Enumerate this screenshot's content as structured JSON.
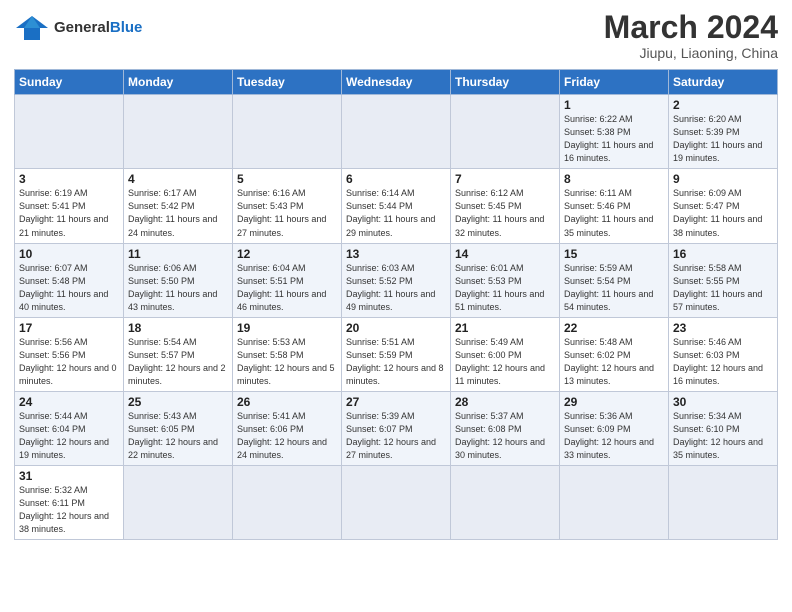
{
  "header": {
    "logo_general": "General",
    "logo_blue": "Blue",
    "month_year": "March 2024",
    "location": "Jiupu, Liaoning, China"
  },
  "weekdays": [
    "Sunday",
    "Monday",
    "Tuesday",
    "Wednesday",
    "Thursday",
    "Friday",
    "Saturday"
  ],
  "weeks": [
    [
      {
        "day": "",
        "info": ""
      },
      {
        "day": "",
        "info": ""
      },
      {
        "day": "",
        "info": ""
      },
      {
        "day": "",
        "info": ""
      },
      {
        "day": "",
        "info": ""
      },
      {
        "day": "1",
        "info": "Sunrise: 6:22 AM\nSunset: 5:38 PM\nDaylight: 11 hours and 16 minutes."
      },
      {
        "day": "2",
        "info": "Sunrise: 6:20 AM\nSunset: 5:39 PM\nDaylight: 11 hours and 19 minutes."
      }
    ],
    [
      {
        "day": "3",
        "info": "Sunrise: 6:19 AM\nSunset: 5:41 PM\nDaylight: 11 hours and 21 minutes."
      },
      {
        "day": "4",
        "info": "Sunrise: 6:17 AM\nSunset: 5:42 PM\nDaylight: 11 hours and 24 minutes."
      },
      {
        "day": "5",
        "info": "Sunrise: 6:16 AM\nSunset: 5:43 PM\nDaylight: 11 hours and 27 minutes."
      },
      {
        "day": "6",
        "info": "Sunrise: 6:14 AM\nSunset: 5:44 PM\nDaylight: 11 hours and 29 minutes."
      },
      {
        "day": "7",
        "info": "Sunrise: 6:12 AM\nSunset: 5:45 PM\nDaylight: 11 hours and 32 minutes."
      },
      {
        "day": "8",
        "info": "Sunrise: 6:11 AM\nSunset: 5:46 PM\nDaylight: 11 hours and 35 minutes."
      },
      {
        "day": "9",
        "info": "Sunrise: 6:09 AM\nSunset: 5:47 PM\nDaylight: 11 hours and 38 minutes."
      }
    ],
    [
      {
        "day": "10",
        "info": "Sunrise: 6:07 AM\nSunset: 5:48 PM\nDaylight: 11 hours and 40 minutes."
      },
      {
        "day": "11",
        "info": "Sunrise: 6:06 AM\nSunset: 5:50 PM\nDaylight: 11 hours and 43 minutes."
      },
      {
        "day": "12",
        "info": "Sunrise: 6:04 AM\nSunset: 5:51 PM\nDaylight: 11 hours and 46 minutes."
      },
      {
        "day": "13",
        "info": "Sunrise: 6:03 AM\nSunset: 5:52 PM\nDaylight: 11 hours and 49 minutes."
      },
      {
        "day": "14",
        "info": "Sunrise: 6:01 AM\nSunset: 5:53 PM\nDaylight: 11 hours and 51 minutes."
      },
      {
        "day": "15",
        "info": "Sunrise: 5:59 AM\nSunset: 5:54 PM\nDaylight: 11 hours and 54 minutes."
      },
      {
        "day": "16",
        "info": "Sunrise: 5:58 AM\nSunset: 5:55 PM\nDaylight: 11 hours and 57 minutes."
      }
    ],
    [
      {
        "day": "17",
        "info": "Sunrise: 5:56 AM\nSunset: 5:56 PM\nDaylight: 12 hours and 0 minutes."
      },
      {
        "day": "18",
        "info": "Sunrise: 5:54 AM\nSunset: 5:57 PM\nDaylight: 12 hours and 2 minutes."
      },
      {
        "day": "19",
        "info": "Sunrise: 5:53 AM\nSunset: 5:58 PM\nDaylight: 12 hours and 5 minutes."
      },
      {
        "day": "20",
        "info": "Sunrise: 5:51 AM\nSunset: 5:59 PM\nDaylight: 12 hours and 8 minutes."
      },
      {
        "day": "21",
        "info": "Sunrise: 5:49 AM\nSunset: 6:00 PM\nDaylight: 12 hours and 11 minutes."
      },
      {
        "day": "22",
        "info": "Sunrise: 5:48 AM\nSunset: 6:02 PM\nDaylight: 12 hours and 13 minutes."
      },
      {
        "day": "23",
        "info": "Sunrise: 5:46 AM\nSunset: 6:03 PM\nDaylight: 12 hours and 16 minutes."
      }
    ],
    [
      {
        "day": "24",
        "info": "Sunrise: 5:44 AM\nSunset: 6:04 PM\nDaylight: 12 hours and 19 minutes."
      },
      {
        "day": "25",
        "info": "Sunrise: 5:43 AM\nSunset: 6:05 PM\nDaylight: 12 hours and 22 minutes."
      },
      {
        "day": "26",
        "info": "Sunrise: 5:41 AM\nSunset: 6:06 PM\nDaylight: 12 hours and 24 minutes."
      },
      {
        "day": "27",
        "info": "Sunrise: 5:39 AM\nSunset: 6:07 PM\nDaylight: 12 hours and 27 minutes."
      },
      {
        "day": "28",
        "info": "Sunrise: 5:37 AM\nSunset: 6:08 PM\nDaylight: 12 hours and 30 minutes."
      },
      {
        "day": "29",
        "info": "Sunrise: 5:36 AM\nSunset: 6:09 PM\nDaylight: 12 hours and 33 minutes."
      },
      {
        "day": "30",
        "info": "Sunrise: 5:34 AM\nSunset: 6:10 PM\nDaylight: 12 hours and 35 minutes."
      }
    ],
    [
      {
        "day": "31",
        "info": "Sunrise: 5:32 AM\nSunset: 6:11 PM\nDaylight: 12 hours and 38 minutes."
      },
      {
        "day": "",
        "info": ""
      },
      {
        "day": "",
        "info": ""
      },
      {
        "day": "",
        "info": ""
      },
      {
        "day": "",
        "info": ""
      },
      {
        "day": "",
        "info": ""
      },
      {
        "day": "",
        "info": ""
      }
    ]
  ]
}
